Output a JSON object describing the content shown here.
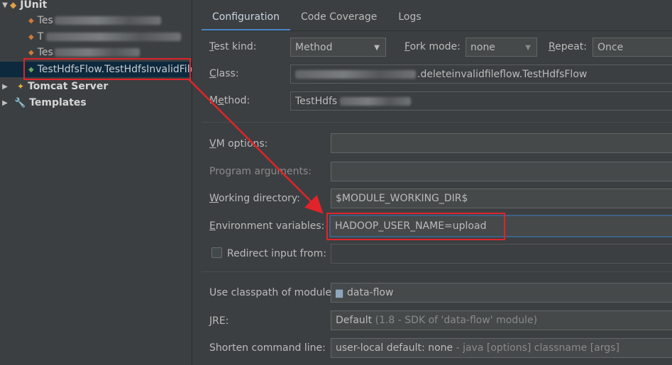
{
  "tree": {
    "junit_label": "JUnit",
    "item1_prefix": "Tes",
    "item2_prefix": "T",
    "item3_prefix": "Tes",
    "selected_label": "TestHdfsFlow.TestHdfsInvalidFile",
    "tomcat_label": "Tomcat Server",
    "templates_label": "Templates"
  },
  "tabs": [
    "Configuration",
    "Code Coverage",
    "Logs"
  ],
  "form": {
    "test_kind": {
      "mnemonic": "T",
      "rest": "est kind:",
      "value": "Method"
    },
    "fork_mode": {
      "mnemonic": "F",
      "rest": "ork mode:",
      "value": "none"
    },
    "repeat": {
      "mnemonic": "R",
      "rest": "epeat:",
      "value": "Once"
    },
    "class": {
      "mnemonic": "C",
      "rest": "lass:",
      "value_suffix": ".deleteinvalidfileflow.TestHdfsFlow"
    },
    "method": {
      "prefix": "M",
      "mnemonic": "e",
      "rest": "thod:",
      "value_prefix": "TestHdfs"
    },
    "vm_options": {
      "mnemonic": "V",
      "rest": "M options:",
      "value": ""
    },
    "program_arguments": {
      "label": "Program arguments:",
      "value": ""
    },
    "working_directory": {
      "mnemonic": "W",
      "rest": "orking directory:",
      "value": "$MODULE_WORKING_DIR$"
    },
    "environment_variables": {
      "mnemonic": "E",
      "rest": "nvironment variables:",
      "value": "HADOOP_USER_NAME=upload"
    },
    "redirect_input": {
      "label": "Redirect input from:",
      "value": ""
    },
    "classpath_module": {
      "label": "Use classpath of module:",
      "value": "data-flow"
    },
    "jre": {
      "mnemonic": "J",
      "rest": "RE:",
      "value": "Default",
      "detail": "(1.8 - SDK of 'data-flow' module)"
    },
    "shorten_command_line": {
      "label": "Shorten command line:",
      "value": "user-local default: none",
      "detail": "- java [options] classname [args]"
    }
  },
  "colors": {
    "highlight_red": "#e0242a",
    "accent_blue": "#4a88c7"
  }
}
